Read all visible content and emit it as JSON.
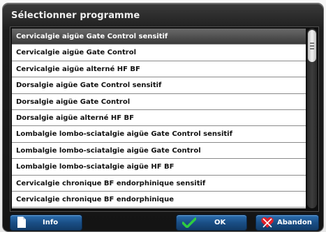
{
  "dialog": {
    "title": "Sélectionner programme"
  },
  "programs": [
    {
      "label": "Cervicalgie aigüe Gate Control sensitif",
      "selected": true
    },
    {
      "label": "Cervicalgie aigüe Gate Control",
      "selected": false
    },
    {
      "label": "Cervicalgie aigüe alterné HF BF",
      "selected": false
    },
    {
      "label": "Dorsalgie aigüe Gate Control sensitif",
      "selected": false
    },
    {
      "label": "Dorsalgie aigüe Gate Control",
      "selected": false
    },
    {
      "label": "Dorsalgie aigüe alterné HF BF",
      "selected": false
    },
    {
      "label": "Lombalgie lombo-sciatalgie aigüe Gate Control sensitif",
      "selected": false
    },
    {
      "label": "Lombalgie lombo-sciatalgie aigüe Gate Control",
      "selected": false
    },
    {
      "label": "Lombalgie lombo-sciatalgie aigüe HF BF",
      "selected": false
    },
    {
      "label": "Cervicalgie chronique BF endorphinique sensitif",
      "selected": false
    },
    {
      "label": "Cervicalgie chronique BF endorphinique",
      "selected": false
    }
  ],
  "buttons": {
    "info": {
      "label": "Info",
      "icon": "document-icon"
    },
    "ok": {
      "label": "OK",
      "icon": "checkmark-icon"
    },
    "abandon": {
      "label": "Abandon",
      "icon": "heart-cross-icon"
    }
  },
  "colors": {
    "selected_row": "#4a4a4a",
    "button_blue": "#1a4f86",
    "ok_check": "#2ecc40",
    "abandon_red": "#e0202a"
  }
}
